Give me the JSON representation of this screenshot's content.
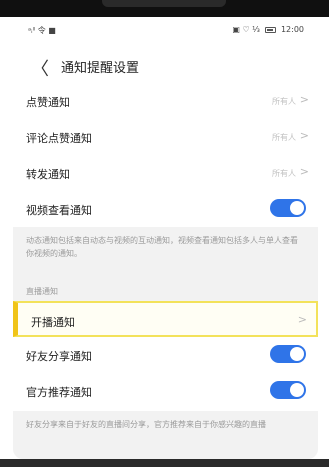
{
  "statusbar": {
    "left": "ᵃᵢˡˡ 令 ■",
    "right": "▣ ♡ ⅓ ",
    "time": "12:00"
  },
  "header": {
    "back_icon": "chevron-left",
    "title": "通知提醒设置"
  },
  "settings": [
    {
      "label": "点赞通知",
      "value": "所有人"
    },
    {
      "label": "评论点赞通知",
      "value": "所有人"
    },
    {
      "label": "转发通知",
      "value": "所有人"
    },
    {
      "label": "视频查看通知",
      "toggle": true
    }
  ],
  "notes": {
    "dynamic": "动态通知包括来自动态与视频的互动通知，视频查看通知包括多人与单人查看你视频的通知。",
    "live": "好友分享来自于好友的直播间分享，官方推荐来自于你感兴趣的直播"
  },
  "live_section": {
    "title": "直播通知",
    "items": [
      {
        "label": "开播通知"
      },
      {
        "label": "好友分享通知",
        "toggle": true
      },
      {
        "label": "官方推荐通知",
        "toggle": true
      }
    ]
  },
  "colors": {
    "accent": "#2f74e8",
    "highlight_border": "#f0c419"
  }
}
